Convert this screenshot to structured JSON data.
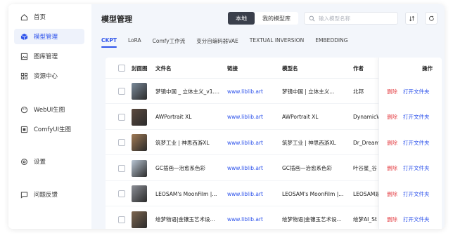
{
  "sidebar": {
    "items": [
      {
        "label": "首页",
        "icon": "home-icon"
      },
      {
        "label": "模型管理",
        "icon": "cube-icon"
      },
      {
        "label": "图库管理",
        "icon": "image-icon"
      },
      {
        "label": "资源中心",
        "icon": "grid-icon"
      },
      {
        "label": "WebUI生图",
        "icon": "palette-icon"
      },
      {
        "label": "ComfyUI生图",
        "icon": "frame-icon"
      },
      {
        "label": "设置",
        "icon": "gear-icon"
      },
      {
        "label": "问题反馈",
        "icon": "message-icon"
      }
    ]
  },
  "header": {
    "title": "模型管理",
    "segment": {
      "local": "本地",
      "mine": "我的模型库"
    },
    "search_placeholder": "输入模型名称"
  },
  "tabs": [
    "CKPT",
    "LoRA",
    "Comfy工作流",
    "变分自编码器VAE",
    "TEXTUAL INVERSION",
    "EMBEDDING"
  ],
  "table": {
    "columns": {
      "cover": "封面图",
      "filename": "文件名",
      "link": "链接",
      "model_name": "模型名",
      "author": "作者",
      "ops": "操作"
    },
    "ops": {
      "delete": "删除",
      "open_folder": "打开文件夹"
    },
    "rows": [
      {
        "filename": "梦镜中国 _ 立体主义_v1....",
        "link": "www.liblib.art",
        "model_name": "梦镜中国 | 立体主义...",
        "author": "北邦",
        "thumb": "#7a8a9a"
      },
      {
        "filename": "AWPortrait XL",
        "link": "www.liblib.art",
        "model_name": "AWPortrait XL",
        "author": "DynamicW",
        "thumb": "#5b4a3f"
      },
      {
        "filename": "筑梦工业 | 神思西游XL",
        "link": "www.liblib.art",
        "model_name": "筑梦工业 | 神思西游XL",
        "author": "Dr_Dream",
        "thumb": "#a07a55"
      },
      {
        "filename": "GC插画—治愈系色彩",
        "link": "www.liblib.art",
        "model_name": "GC插画—治愈系色彩",
        "author": "叶谷星_谷",
        "thumb": "#b9c6d4"
      },
      {
        "filename": "LEOSAM's MoonFilm |...",
        "link": "www.liblib.art",
        "model_name": "LEOSAM's MoonFilm |...",
        "author": "LEOSAM是",
        "thumb": "#8c8f96"
      },
      {
        "filename": "绘梦物语|金镶玉艺术设...",
        "link": "www.liblib.art",
        "model_name": "绘梦物语|金镶玉艺术设...",
        "author": "绘梦AI_St",
        "thumb": "#7d6650"
      }
    ]
  },
  "colors": {
    "accent": "#2f54eb",
    "danger": "#e5484d",
    "active_bg": "#eef2fb",
    "main_bg": "#f3f6fb"
  }
}
